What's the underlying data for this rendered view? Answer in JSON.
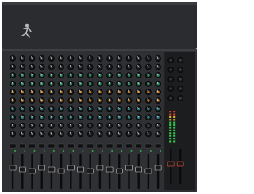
{
  "device": {
    "type": "analog mixing console",
    "logo_icon": "running-man-logo-icon",
    "input_channels": 16,
    "knob_rows_per_channel": 10,
    "colors": {
      "panel": "#2f3033",
      "panel_dark": "#1c1d1f",
      "knob": "#121314",
      "knob_highlight": "#3a3b3e",
      "eq_cap_green": "#2f8a63",
      "eq_cap_orange": "#b9741f",
      "eq_cap_teal": "#2a7d83",
      "mute_button": "#101112",
      "led_green": "#34c94a",
      "fader_slot": "#0b0b0c",
      "fader_cap": "#cfcfcf"
    },
    "knob_row_caps": [
      "plain",
      "plain",
      "green",
      "green",
      "orange",
      "orange",
      "teal",
      "teal",
      "plain",
      "plain"
    ],
    "master_section": {
      "knob_rows": 5,
      "meter_icon": "level-meter-icon",
      "fader_count": 2
    }
  }
}
